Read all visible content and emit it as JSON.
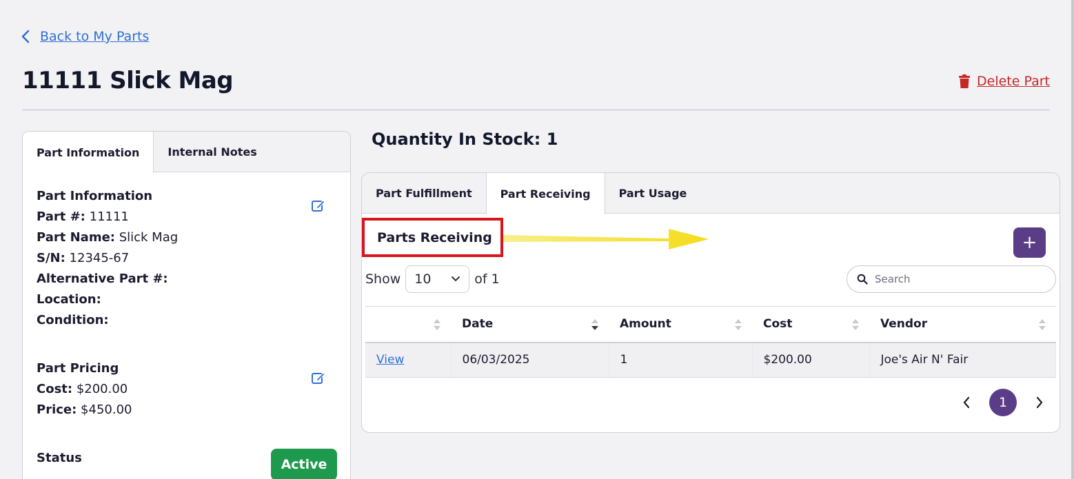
{
  "nav": {
    "back_label": "Back to My Parts"
  },
  "page": {
    "title": "11111 Slick Mag",
    "delete_label": "Delete Part"
  },
  "left_tabs": [
    "Part Information",
    "Internal Notes"
  ],
  "part_info": {
    "heading": "Part Information",
    "fields": [
      {
        "label": "Part #:",
        "value": " 11111"
      },
      {
        "label": "Part Name:",
        "value": " Slick Mag"
      },
      {
        "label": "S/N:",
        "value": " 12345-67"
      },
      {
        "label": "Alternative Part #:",
        "value": ""
      },
      {
        "label": "Location:",
        "value": ""
      },
      {
        "label": "Condition:",
        "value": ""
      }
    ]
  },
  "pricing": {
    "heading": "Part Pricing",
    "fields": [
      {
        "label": "Cost:",
        "value": " $200.00"
      },
      {
        "label": "Price:",
        "value": " $450.00"
      }
    ]
  },
  "status": {
    "heading": "Status",
    "value": "Active"
  },
  "stock": {
    "label": "Quantity In Stock: 1"
  },
  "right_tabs": [
    "Part Fulfillment",
    "Part Receiving",
    "Part Usage"
  ],
  "receiving": {
    "title": "Parts Receiving",
    "add_label": "+",
    "show_label": "Show",
    "page_size": "10",
    "of_label": "of 1",
    "search_placeholder": "Search",
    "columns": [
      "",
      "Date",
      "Amount",
      "Cost",
      "Vendor"
    ],
    "rows": [
      {
        "action": "View",
        "date": "06/03/2025",
        "amount": "1",
        "cost": "$200.00",
        "vendor": "Joe's Air N' Fair"
      }
    ],
    "current_page": "1"
  },
  "colors": {
    "accent": "#5a3d86",
    "link": "#2f6fd6",
    "danger": "#c62828",
    "success": "#1e9a4e",
    "highlight_box": "#d9141b",
    "arrow": "#f5e032"
  }
}
